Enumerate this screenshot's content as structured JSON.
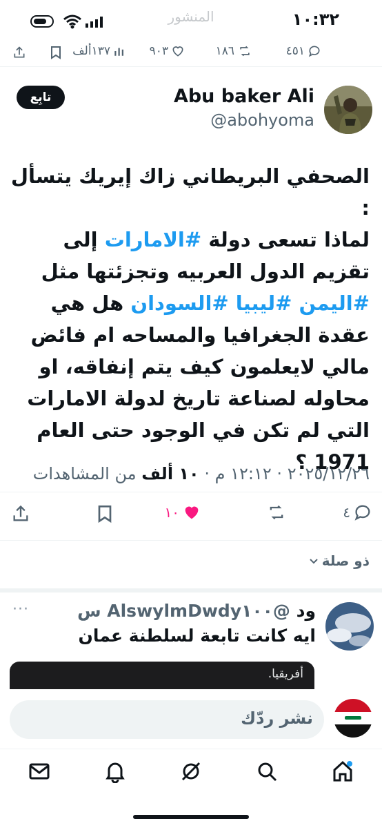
{
  "status": {
    "time": "١٠:٣٢",
    "ghost_title": "المنشور"
  },
  "engagement_top": {
    "replies": "٤٥١",
    "reposts": "١٨٦",
    "likes": "٩٠٣",
    "views": "١٣٧ألف"
  },
  "author": {
    "display_name": "Abu baker Ali",
    "handle": "@abohyoma",
    "follow_label": "تابِع"
  },
  "tweet": {
    "line1": "الصحفي البريطاني زاك إيريك يتسأل :",
    "line2_pre": "لماذا تسعى دولة ",
    "line2_tag": "#الامارات",
    "line2_post": "  إلى",
    "line3": "تقزيم الدول العربيه وتجزئتها مثل",
    "line4_tags": "#اليمن #ليبيا #السودان",
    "line4_post": " هل هي",
    "line5": "عقدة الجغرافيا والمساحه ام فائض",
    "line6": "مالي لايعلمون كيف يتم إنفاقه، او",
    "line7": "محاوله لصناعة تاريخ لدولة الامارات",
    "line8": "التي لم تكن في الوجود حتى العام",
    "line9": "1971 ؟"
  },
  "meta": {
    "date": "٢٠٢٥/١٢/٢٦",
    "time": "١٢:١٢ م",
    "views_count": "١٠ ألف",
    "views_label": "من المشاهدات",
    "sep": "·"
  },
  "actions": {
    "replies": "٤",
    "likes": "١٠",
    "like_color": "#f91880"
  },
  "filter": {
    "label": "ذو صلة"
  },
  "reply": {
    "name": "ود",
    "handle": "@AlswylmDwdy",
    "time": "١٠٠ س",
    "text": "ايه كانت تابعة لسلطنة عمان",
    "more": "···"
  },
  "toast": {
    "text": "أفريقيا."
  },
  "compose": {
    "placeholder": "نشر ردّك"
  },
  "nav": {
    "items": [
      "home-icon",
      "search-icon",
      "grok-icon",
      "notifications-icon",
      "messages-icon"
    ]
  },
  "colors": {
    "accent": "#1d9bf0",
    "text": "#0f1419",
    "muted": "#536471"
  }
}
